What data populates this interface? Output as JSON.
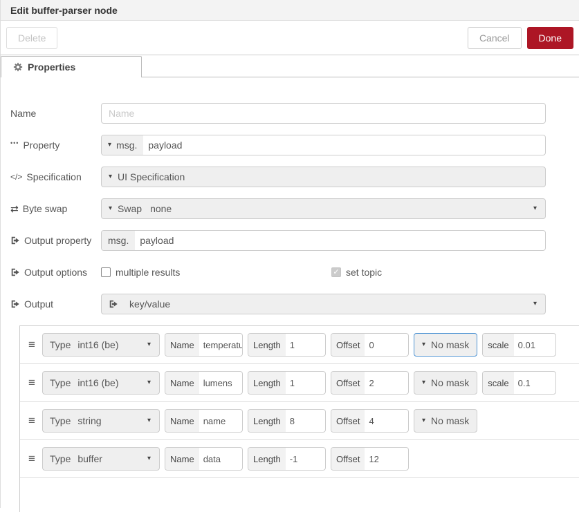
{
  "dialog": {
    "title": "Edit buffer-parser node",
    "delete_label": "Delete",
    "cancel_label": "Cancel",
    "done_label": "Done",
    "tab_label": "Properties"
  },
  "form": {
    "name": {
      "label": "Name",
      "placeholder": "Name",
      "value": ""
    },
    "property": {
      "label": "Property",
      "prefix": "msg.",
      "value": "payload"
    },
    "specification": {
      "label": "Specification",
      "value": "UI Specification"
    },
    "byteswap": {
      "label": "Byte swap",
      "prefix": "Swap",
      "value": "none"
    },
    "output_property": {
      "label": "Output property",
      "prefix": "msg.",
      "value": "payload"
    },
    "output_options": {
      "label": "Output options",
      "multiple_results": {
        "label": "multiple results",
        "checked": false
      },
      "set_topic": {
        "label": "set topic",
        "checked": true,
        "disabled": true
      }
    },
    "output": {
      "label": "Output",
      "value": "key/value"
    }
  },
  "items": {
    "field_labels": {
      "type": "Type",
      "name": "Name",
      "length": "Length",
      "offset": "Offset",
      "mask": "No mask",
      "scale": "scale"
    },
    "rows": [
      {
        "type": "int16 (be)",
        "name": "temperatu",
        "length": "1",
        "offset": "0",
        "mask": "No mask",
        "mask_focused": true,
        "scale": "0.01"
      },
      {
        "type": "int16 (be)",
        "name": "lumens",
        "length": "1",
        "offset": "2",
        "mask": "No mask",
        "scale": "0.1"
      },
      {
        "type": "string",
        "name": "name",
        "length": "8",
        "offset": "4",
        "mask": "No mask"
      },
      {
        "type": "buffer",
        "name": "data",
        "length": "-1",
        "offset": "12"
      }
    ]
  },
  "colors": {
    "done_button_bg": "#AD1625",
    "mask_focus_border": "#4f94d4",
    "header_bg": "#f3f3f3"
  }
}
